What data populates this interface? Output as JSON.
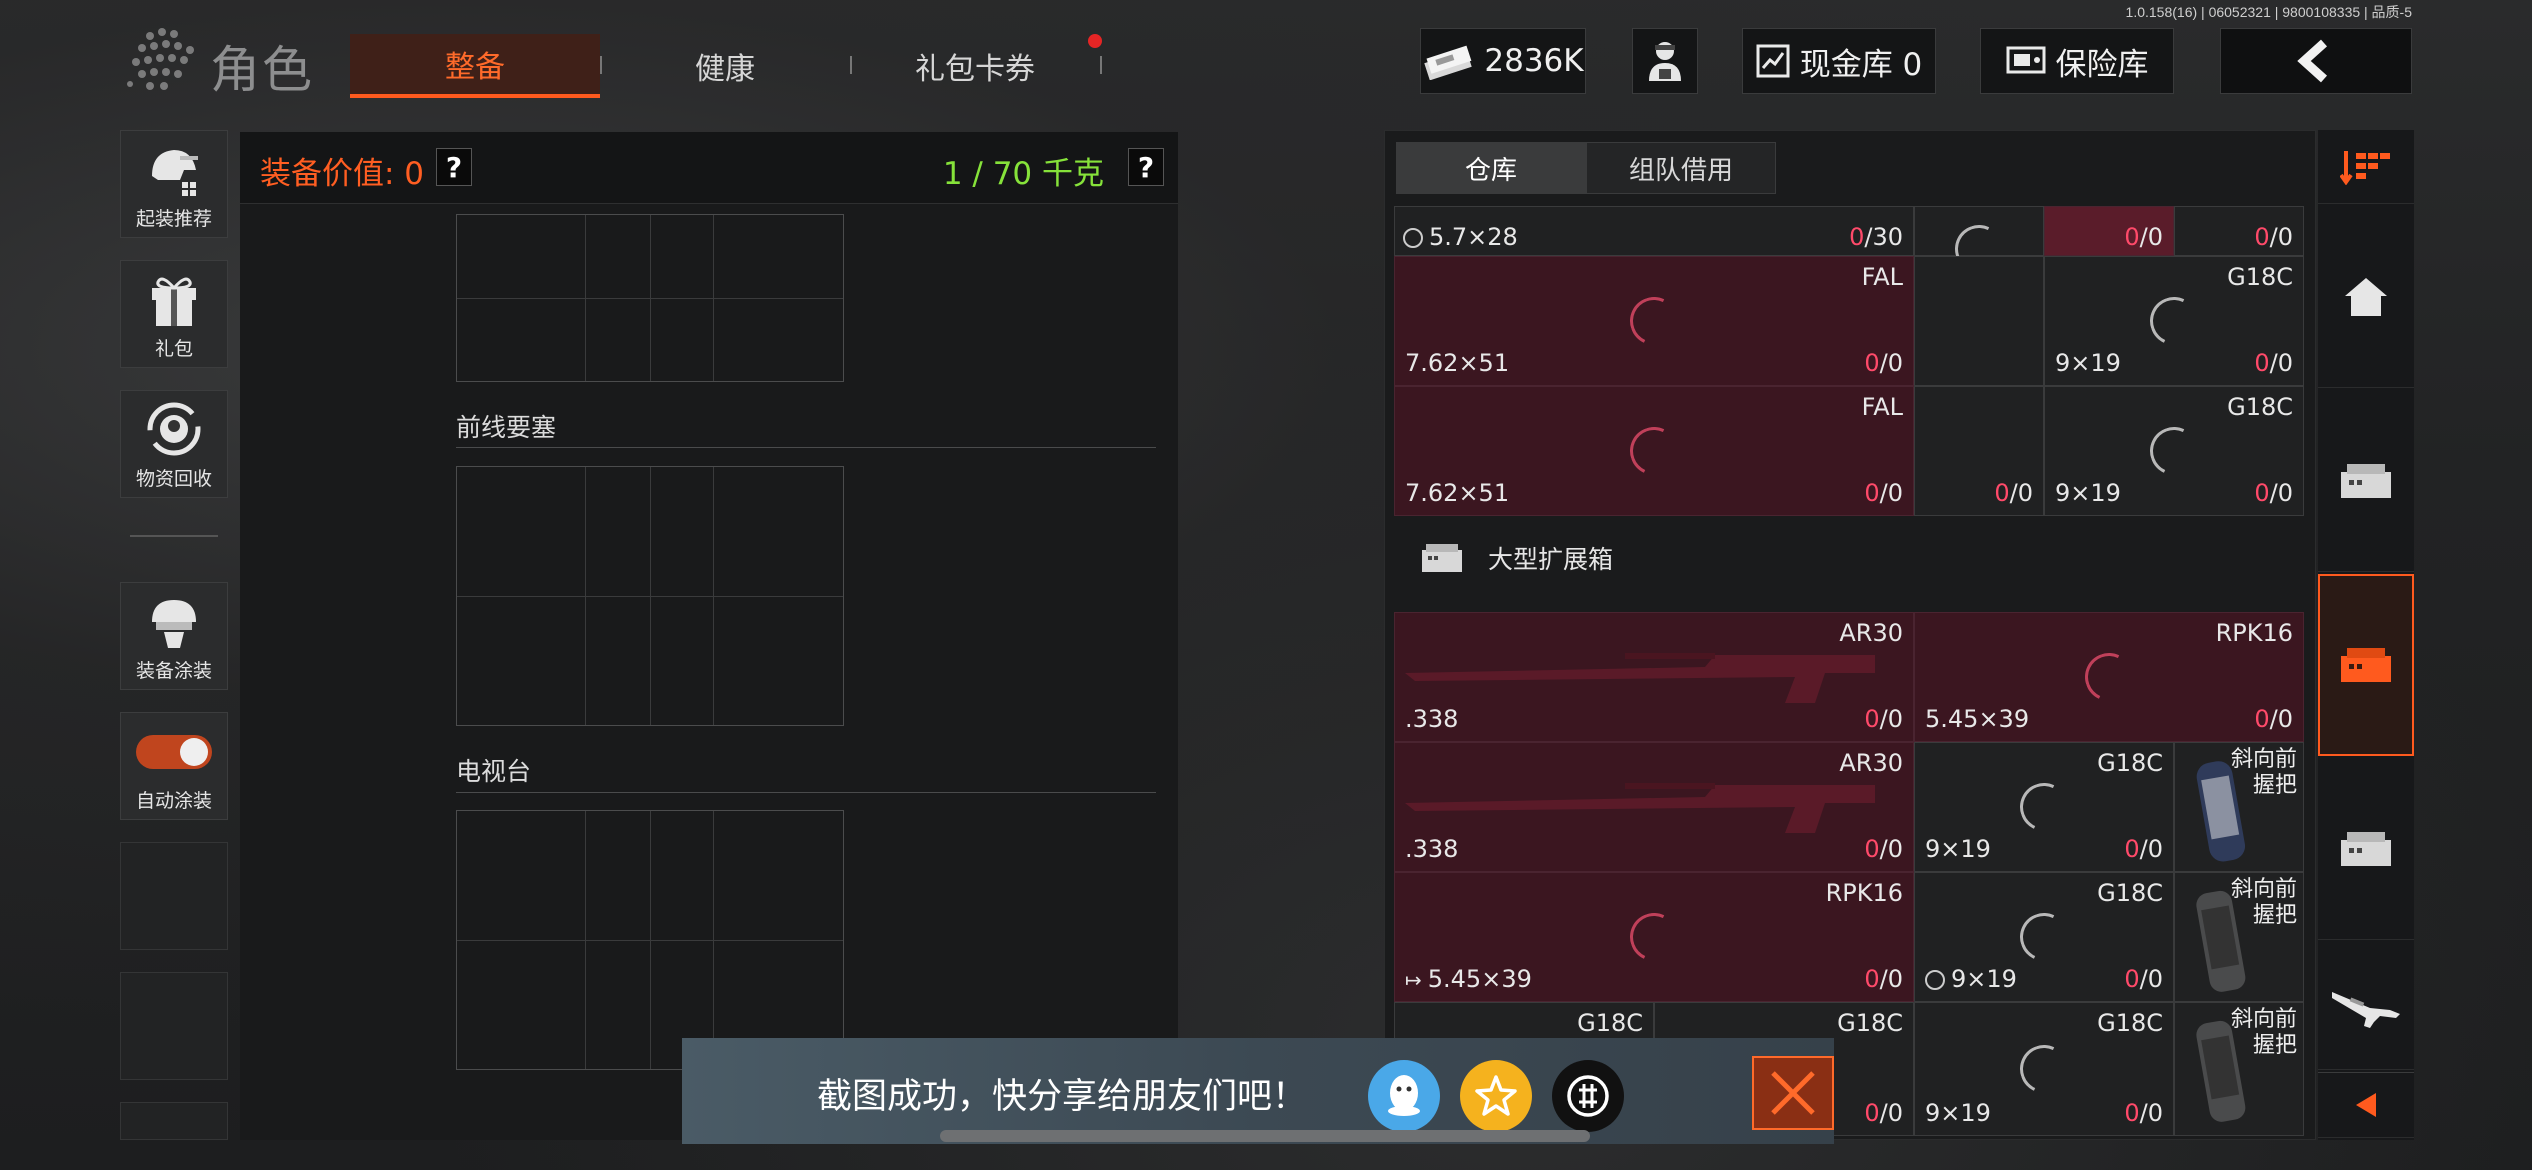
{
  "version": "1.0.158(16) | 06052321 | 9800108335 | 品质-5",
  "header": {
    "title": "角色",
    "tabs": [
      {
        "label": "整备",
        "active": true
      },
      {
        "label": "健康",
        "active": false
      },
      {
        "label": "礼包卡券",
        "active": false,
        "has_dot": true
      }
    ],
    "currency": "2836K",
    "cash_vault": "现金库 0",
    "safe": "保险库"
  },
  "sidebar": {
    "items": [
      {
        "label": "起装推荐",
        "icon": "helmet-gear-icon"
      },
      {
        "label": "礼包",
        "icon": "gift-icon"
      },
      {
        "label": "物资回收",
        "icon": "recycle-icon"
      },
      {
        "label": "装备涂装",
        "icon": "skin-icon"
      },
      {
        "label": "自动涂装",
        "icon": "toggle-icon",
        "toggle_on": true
      }
    ]
  },
  "equipment": {
    "value_label": "装备价值: 0",
    "weight_label": "1 / 70 千克",
    "help": "?",
    "sections": [
      "前线要塞",
      "电视台"
    ]
  },
  "warehouse": {
    "tabs": [
      {
        "label": "仓库",
        "active": true
      },
      {
        "label": "组队借用",
        "active": false
      }
    ],
    "box_title": "大型扩展箱",
    "top_cells": [
      {
        "caliber": "5.7×28",
        "count_used": "0",
        "count_total": "/30"
      },
      {
        "count_used": "0",
        "count_total": "/0"
      },
      {
        "count_used": "0",
        "count_total": "/0"
      },
      {
        "name": "FAL",
        "caliber": "7.62×51",
        "count_used": "0",
        "count_total": "/0"
      },
      {
        "name": "G18C",
        "caliber": "9×19",
        "count_used": "0",
        "count_total": "/0"
      },
      {
        "name": "FAL",
        "caliber": "7.62×51",
        "count_used": "0",
        "count_total": "/0"
      },
      {
        "count_used": "0",
        "count_total": "/0"
      },
      {
        "name": "G18C",
        "caliber": "9×19",
        "count_used": "0",
        "count_total": "/0"
      }
    ],
    "box_cells": [
      {
        "name": "AR30",
        "caliber": ".338",
        "count_used": "0",
        "count_total": "/0"
      },
      {
        "name": "RPK16",
        "caliber": "5.45×39",
        "count_used": "0",
        "count_total": "/0"
      },
      {
        "name": "AR30",
        "caliber": ".338",
        "count_used": "0",
        "count_total": "/0"
      },
      {
        "name": "G18C",
        "caliber": "9×19",
        "count_used": "0",
        "count_total": "/0"
      },
      {
        "name": "斜向前握把"
      },
      {
        "name": "RPK16",
        "caliber": "5.45×39",
        "count_used": "0",
        "count_total": "/0"
      },
      {
        "name": "G18C",
        "caliber": "9×19",
        "count_used": "0",
        "count_total": "/0"
      },
      {
        "name": "斜向前握把"
      },
      {
        "name": "G18C",
        "count_used": "0",
        "count_total": "/0"
      },
      {
        "name": "G18C",
        "count_used": "0",
        "count_total": "/0"
      },
      {
        "name": "G18C",
        "caliber": "9×19",
        "count_used": "0",
        "count_total": "/0"
      },
      {
        "name": "斜向前握把"
      }
    ]
  },
  "toast": {
    "text": "截图成功，快分享给朋友们吧！"
  },
  "colors": {
    "accent": "#ff5a1e",
    "weight_ok": "#86e23a",
    "count_red": "#ff4a6a",
    "cell_red": "#3b1620"
  }
}
